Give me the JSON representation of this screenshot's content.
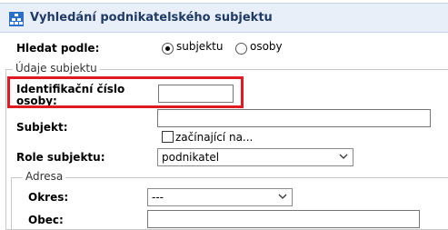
{
  "header": {
    "title": "Vyhledání podnikatelského subjektu",
    "icon": "org-tree-icon"
  },
  "search_by": {
    "label": "Hledat podle:",
    "options": [
      {
        "label": "subjektu",
        "selected": true
      },
      {
        "label": "osoby",
        "selected": false
      }
    ]
  },
  "subject_section": {
    "legend": "Údaje subjektu",
    "id_number": {
      "label_line1": "Identifikační číslo",
      "label_line2": "osoby:",
      "value": ""
    },
    "subject": {
      "label": "Subjekt:",
      "value": "",
      "starts_with_label": "začínající na...",
      "starts_with_checked": false
    },
    "role": {
      "label": "Role subjektu:",
      "selected": "podnikatel"
    }
  },
  "address_section": {
    "legend": "Adresa",
    "district": {
      "label": "Okres:",
      "selected": "---"
    },
    "municipality": {
      "label": "Obec:",
      "value": ""
    }
  },
  "colors": {
    "highlight": "#e01a22",
    "header_bg": "#e8eff8",
    "header_text": "#1f3a64"
  }
}
